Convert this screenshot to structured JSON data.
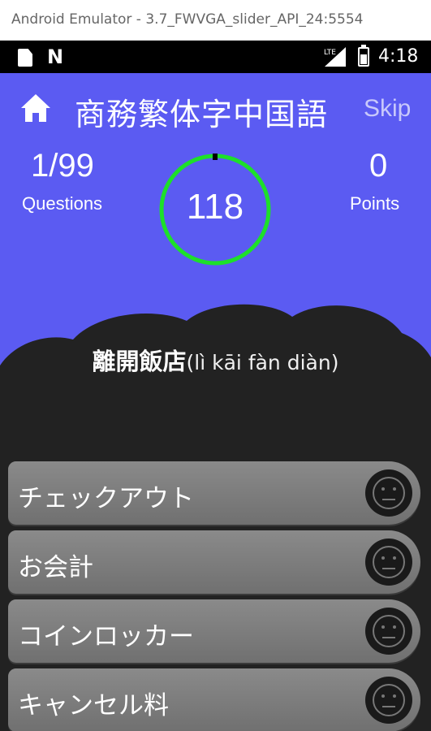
{
  "window": {
    "title": "Android Emulator - 3.7_FWVGA_slider_API_24:5554"
  },
  "statusbar": {
    "time": "4:18",
    "network": "LTE",
    "nfc_glyph": "N"
  },
  "header": {
    "title": "商務繁体字中国語",
    "skip_label": "Skip",
    "home_icon": "home-icon"
  },
  "stats": {
    "questions": {
      "value": "1/99",
      "label": "Questions"
    },
    "points": {
      "value": "0",
      "label": "Points"
    }
  },
  "timer": {
    "value": "118",
    "color": "#1de02a"
  },
  "question": {
    "word": "離開飯店",
    "reading": "(lì kāi fàn diàn)"
  },
  "options": [
    {
      "label": "チェックアウト",
      "icon": "neutral-face-icon"
    },
    {
      "label": "お会計",
      "icon": "neutral-face-icon"
    },
    {
      "label": "コインロッカー",
      "icon": "neutral-face-icon"
    },
    {
      "label": "キャンセル料",
      "icon": "neutral-face-icon"
    }
  ],
  "colors": {
    "background": "#5b5bf2",
    "cloud": "#222222",
    "option": "#7d7d7d"
  }
}
